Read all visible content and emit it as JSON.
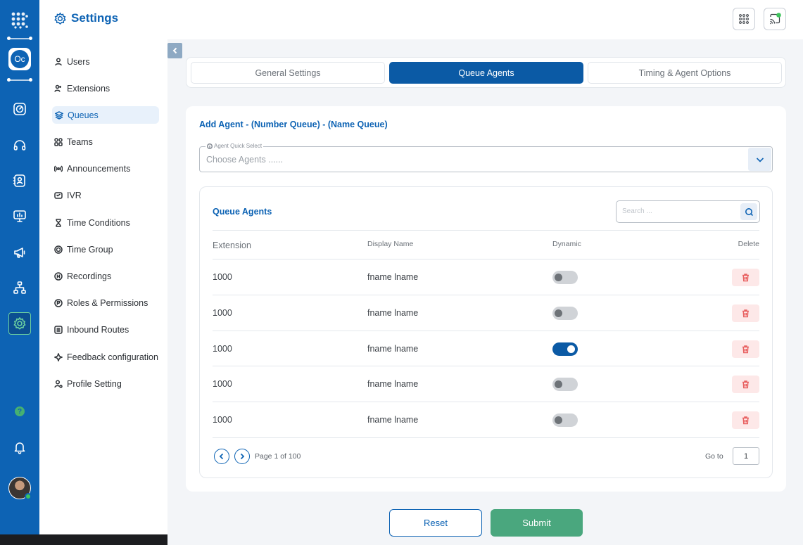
{
  "app": {
    "logo_text": "Oc"
  },
  "sidebar": {
    "title": "Settings",
    "items": [
      {
        "label": "Users",
        "icon": "user-icon"
      },
      {
        "label": "Extensions",
        "icon": "users-icon"
      },
      {
        "label": "Queues",
        "icon": "layers-icon",
        "active": true
      },
      {
        "label": "Teams",
        "icon": "grid-icon"
      },
      {
        "label": "Announcements",
        "icon": "broadcast-icon"
      },
      {
        "label": "IVR",
        "icon": "ivr-icon"
      },
      {
        "label": "Time Conditions",
        "icon": "hourglass-icon"
      },
      {
        "label": "Time Group",
        "icon": "time-group-icon"
      },
      {
        "label": "Recordings",
        "icon": "recording-icon"
      },
      {
        "label": "Roles & Permissions",
        "icon": "roles-icon"
      },
      {
        "label": "Inbound Routes",
        "icon": "routes-icon"
      },
      {
        "label": "Feedback configuration",
        "icon": "feedback-icon"
      },
      {
        "label": "Profile Setting",
        "icon": "profile-icon"
      }
    ]
  },
  "rail": {
    "help_label": "?"
  },
  "tabs": [
    {
      "label": "General Settings",
      "active": false
    },
    {
      "label": "Queue Agents",
      "active": true
    },
    {
      "label": "Timing & Agent Options",
      "active": false
    }
  ],
  "card": {
    "title": "Add Agent - (Number Queue) - (Name Queue)",
    "select_label": "Agent Quick Select",
    "select_placeholder": "Choose Agents ......"
  },
  "agents": {
    "title": "Queue Agents",
    "search_placeholder": "Search ...",
    "columns": {
      "extension": "Extension",
      "display_name": "Display Name",
      "dynamic": "Dynamic",
      "delete": "Delete"
    },
    "rows": [
      {
        "extension": "1000",
        "display_name": "fname lname",
        "dynamic": false
      },
      {
        "extension": "1000",
        "display_name": "fname lname",
        "dynamic": false
      },
      {
        "extension": "1000",
        "display_name": "fname lname",
        "dynamic": true
      },
      {
        "extension": "1000",
        "display_name": "fname lname",
        "dynamic": false
      },
      {
        "extension": "1000",
        "display_name": "fname lname",
        "dynamic": false
      }
    ],
    "pager": {
      "text": "Page 1 of 100",
      "goto_label": "Go to",
      "goto_value": "1"
    }
  },
  "actions": {
    "reset": "Reset",
    "submit": "Submit"
  },
  "colors": {
    "primary": "#0d63b4",
    "success": "#4aa77e",
    "danger": "#e86060"
  }
}
